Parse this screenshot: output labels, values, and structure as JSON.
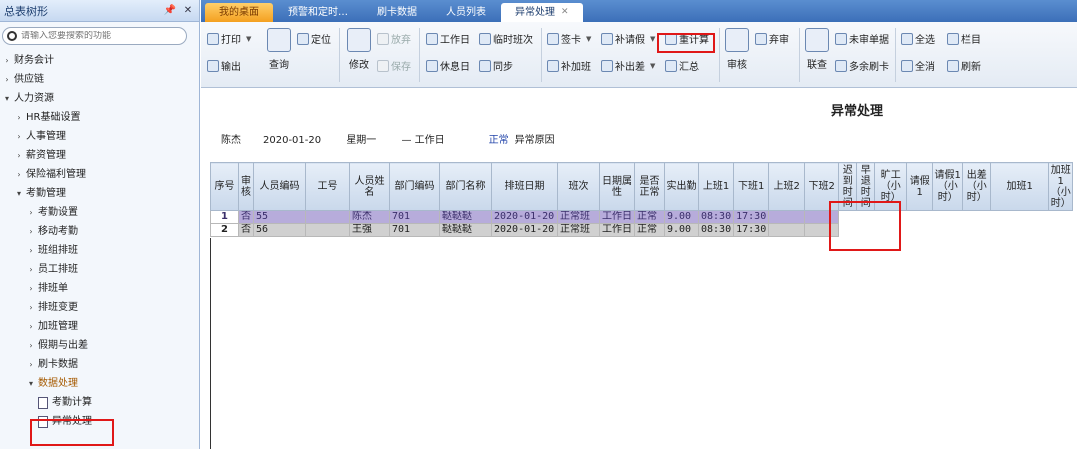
{
  "sidebar": {
    "header": "总表树形",
    "search_placeholder": "请输入您要搜索的功能",
    "items": [
      {
        "label": "财务会计",
        "level": 0,
        "expanded": false
      },
      {
        "label": "供应链",
        "level": 0,
        "expanded": false
      },
      {
        "label": "人力资源",
        "level": 0,
        "expanded": true
      },
      {
        "label": "HR基础设置",
        "level": 1,
        "expanded": false
      },
      {
        "label": "人事管理",
        "level": 1,
        "expanded": false
      },
      {
        "label": "薪资管理",
        "level": 1,
        "expanded": false
      },
      {
        "label": "保险福利管理",
        "level": 1,
        "expanded": false
      },
      {
        "label": "考勤管理",
        "level": 1,
        "expanded": true
      },
      {
        "label": "考勤设置",
        "level": 2,
        "expanded": false
      },
      {
        "label": "移动考勤",
        "level": 2,
        "expanded": false
      },
      {
        "label": "班组排班",
        "level": 2,
        "expanded": false
      },
      {
        "label": "员工排班",
        "level": 2,
        "expanded": false
      },
      {
        "label": "排班单",
        "level": 2,
        "expanded": false
      },
      {
        "label": "排班变更",
        "level": 2,
        "expanded": false
      },
      {
        "label": "加班管理",
        "level": 2,
        "expanded": false
      },
      {
        "label": "假期与出差",
        "level": 2,
        "expanded": false
      },
      {
        "label": "刷卡数据",
        "level": 2,
        "expanded": false
      },
      {
        "label": "数据处理",
        "level": 2,
        "expanded": true,
        "selected": true
      },
      {
        "label": "考勤计算",
        "level": 3,
        "doc": true
      },
      {
        "label": "异常处理",
        "level": 3,
        "doc": true,
        "highlighted": true
      }
    ]
  },
  "tabs": [
    {
      "label": "我的桌面",
      "type": "home"
    },
    {
      "label": "预警和定时…",
      "type": "normal"
    },
    {
      "label": "刷卡数据",
      "type": "normal"
    },
    {
      "label": "人员列表",
      "type": "normal"
    },
    {
      "label": "异常处理",
      "type": "active",
      "close": "✕"
    }
  ],
  "toolbar": {
    "print": "打印",
    "export": "输出",
    "query": "查询",
    "locate": "定位",
    "edit": "修改",
    "discard": "放弃",
    "save": "保存",
    "workday": "工作日",
    "restday": "休息日",
    "temp_shift": "临时班次",
    "sync": "同步",
    "signcard": "签卡",
    "fill_leave": "补请假",
    "add_overtime": "补加班",
    "fill_trip": "补出差",
    "recalc": "重计算",
    "summary": "汇总",
    "audit": "审核",
    "unaudit": "弃审",
    "joinquery": "联查",
    "unaudited_doc": "未审单据",
    "extra_swipe": "多余刷卡",
    "select_all": "全选",
    "deselect_all": "全消",
    "columns": "栏目",
    "refresh": "刷新"
  },
  "page": {
    "title": "异常处理",
    "person": "陈杰",
    "date": "2020-01-20",
    "weekday": "星期一",
    "daytype": "工作日",
    "status": "正常",
    "reason_label": "异常原因"
  },
  "grid": {
    "columns": [
      "序号",
      "审核",
      "人员编码",
      "工号",
      "人员姓名",
      "部门编码",
      "部门名称",
      "排班日期",
      "班次",
      "日期属性",
      "是否正常",
      "实出勤",
      "上班1",
      "下班1",
      "上班2",
      "下班2",
      "迟到时间",
      "早退时间",
      "旷工（小时）",
      "请假1",
      "请假1（小时）",
      "出差（小时）",
      "加班1",
      "加班1（小时）"
    ],
    "rows": [
      [
        "1",
        "否",
        "55",
        "",
        "陈杰",
        "701",
        "鞑鞑鞑",
        "2020-01-20",
        "正常班",
        "工作日",
        "正常",
        "9.00",
        "08:30",
        "17:30",
        "",
        ""
      ],
      [
        "2",
        "否",
        "56",
        "",
        "王强",
        "701",
        "鞑鞑鞑",
        "2020-01-20",
        "正常班",
        "工作日",
        "正常",
        "9.00",
        "08:30",
        "17:30",
        "",
        ""
      ]
    ]
  }
}
